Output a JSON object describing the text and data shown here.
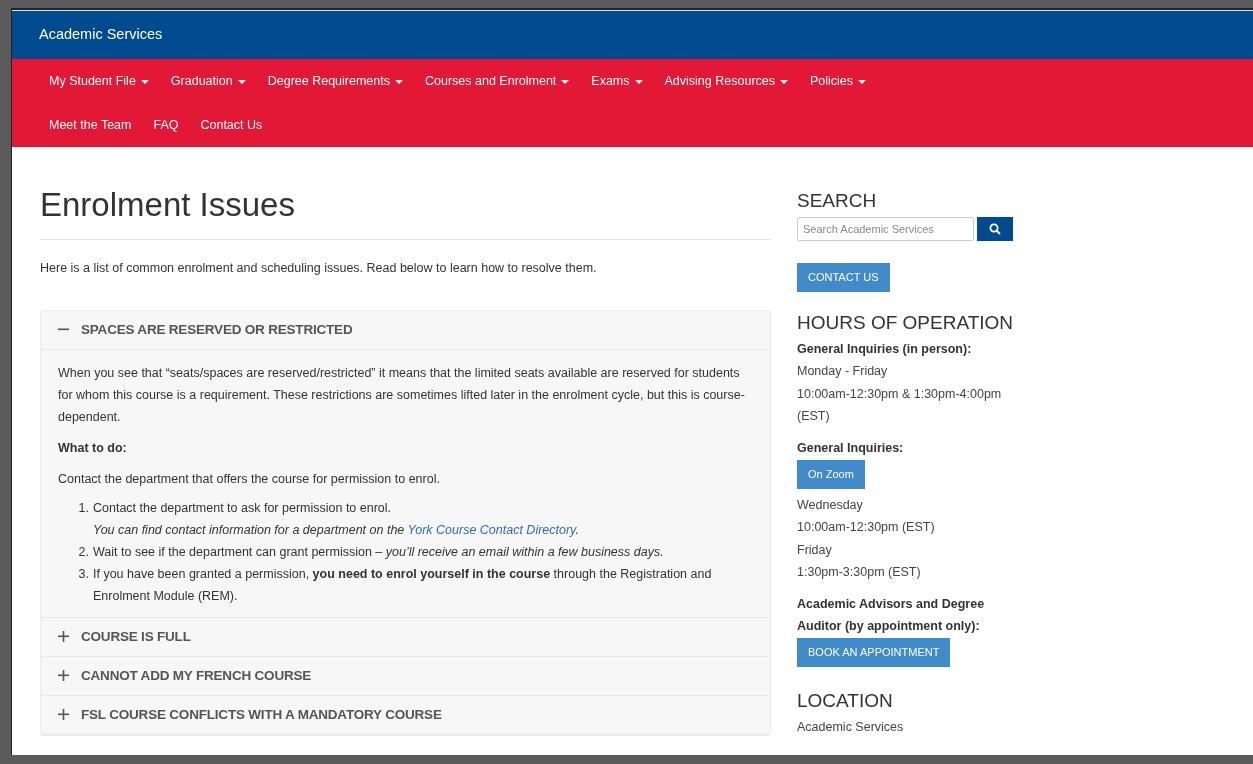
{
  "site_title": "Academic Services",
  "nav": [
    {
      "label": "My Student File",
      "dropdown": true
    },
    {
      "label": "Graduation",
      "dropdown": true
    },
    {
      "label": "Degree Requirements",
      "dropdown": true
    },
    {
      "label": "Courses and Enrolment",
      "dropdown": true
    },
    {
      "label": "Exams",
      "dropdown": true
    },
    {
      "label": "Advising Resources",
      "dropdown": true
    },
    {
      "label": "Policies",
      "dropdown": true
    },
    {
      "label": "Meet the Team",
      "dropdown": false
    },
    {
      "label": "FAQ",
      "dropdown": false
    },
    {
      "label": "Contact Us",
      "dropdown": false
    }
  ],
  "page_title": "Enrolment Issues",
  "intro": "Here is a list of common enrolment and scheduling issues. Read below to learn how to resolve them.",
  "accordion": [
    {
      "title": "SPACES ARE RESERVED OR RESTRICTED",
      "expanded": true,
      "body": {
        "paragraph": "When you see that “seats/spaces are reserved/restricted” it means that the limited seats available are reserved for students for whom this course is a requirement. These restrictions are sometimes lifted later in the enrolment cycle, but this is course-dependent.",
        "subheading": "What to do:",
        "instruction": "Contact the department that offers the course for permission to enrol.",
        "steps": [
          {
            "number": "1.",
            "text": "Contact the department to ask for permission to enrol.",
            "note": "You can find contact information for a department on the ",
            "link": "York Course Contact Directory",
            "note_end": "."
          },
          {
            "number": "2.",
            "text": "Wait to see if the department can grant permission – *you’ll receive an email within a few business days.*"
          },
          {
            "number": "3.",
            "text": "If you have been granted a permission, **you need to enrol yourself in the course** through the Registration and Enrolment Module (REM)."
          }
        ]
      }
    },
    {
      "title": "COURSE IS FULL",
      "expanded": false
    },
    {
      "title": "CANNOT ADD MY FRENCH COURSE",
      "expanded": false
    },
    {
      "title": "FSL COURSE CONFLICTS WITH A MANDATORY COURSE",
      "expanded": false
    }
  ],
  "sidebar": {
    "search_heading": "SEARCH",
    "search_placeholder": "Search Academic Services",
    "contact_button": "CONTACT US",
    "hours_heading": "HOURS OF OPERATION",
    "hours": [
      {
        "kind": "label",
        "text": "General Inquiries (in person):"
      },
      {
        "kind": "line",
        "text": "Monday - Friday"
      },
      {
        "kind": "line",
        "text": "10:00am-12:30pm & 1:30pm-4:00pm (EST)"
      },
      {
        "kind": "label",
        "text": "General Inquiries:"
      },
      {
        "kind": "button",
        "text": "On Zoom"
      },
      {
        "kind": "line",
        "text": "Wednesday"
      },
      {
        "kind": "line",
        "text": "10:00am-12:30pm (EST)"
      },
      {
        "kind": "line",
        "text": "Friday"
      },
      {
        "kind": "line",
        "text": "1:30pm-3:30pm (EST)"
      },
      {
        "kind": "label",
        "text": "Academic Advisors and Degree Auditor (by appointment only):"
      },
      {
        "kind": "button",
        "text": "BOOK AN APPOINTMENT"
      }
    ],
    "location_heading": "LOCATION",
    "location_lines": [
      "Academic Services"
    ]
  }
}
